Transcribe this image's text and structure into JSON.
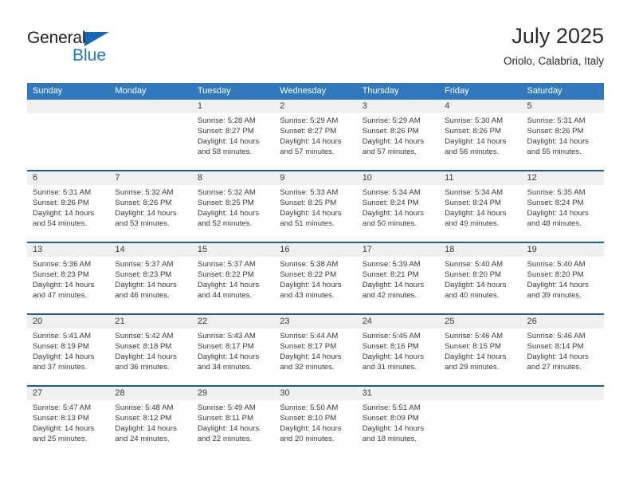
{
  "brand": {
    "name_top": "General",
    "name_bottom": "Blue",
    "triangle_color": "#1667b2",
    "blue_text_color": "#1a7ac4"
  },
  "header": {
    "title": "July 2025",
    "subtitle": "Oriolo, Calabria, Italy"
  },
  "theme": {
    "header_bg": "#3179bc",
    "week_separator": "#1c5fa0",
    "date_band_bg": "#f0f0f0",
    "text": "#3a3a3a"
  },
  "weekdays": [
    "Sunday",
    "Monday",
    "Tuesday",
    "Wednesday",
    "Thursday",
    "Friday",
    "Saturday"
  ],
  "weeks": [
    {
      "days": [
        {
          "num": "",
          "sunrise": "",
          "sunset": "",
          "daylight1": "",
          "daylight2": ""
        },
        {
          "num": "",
          "sunrise": "",
          "sunset": "",
          "daylight1": "",
          "daylight2": ""
        },
        {
          "num": "1",
          "sunrise": "Sunrise: 5:28 AM",
          "sunset": "Sunset: 8:27 PM",
          "daylight1": "Daylight: 14 hours",
          "daylight2": "and 58 minutes."
        },
        {
          "num": "2",
          "sunrise": "Sunrise: 5:29 AM",
          "sunset": "Sunset: 8:27 PM",
          "daylight1": "Daylight: 14 hours",
          "daylight2": "and 57 minutes."
        },
        {
          "num": "3",
          "sunrise": "Sunrise: 5:29 AM",
          "sunset": "Sunset: 8:26 PM",
          "daylight1": "Daylight: 14 hours",
          "daylight2": "and 57 minutes."
        },
        {
          "num": "4",
          "sunrise": "Sunrise: 5:30 AM",
          "sunset": "Sunset: 8:26 PM",
          "daylight1": "Daylight: 14 hours",
          "daylight2": "and 56 minutes."
        },
        {
          "num": "5",
          "sunrise": "Sunrise: 5:31 AM",
          "sunset": "Sunset: 8:26 PM",
          "daylight1": "Daylight: 14 hours",
          "daylight2": "and 55 minutes."
        }
      ]
    },
    {
      "days": [
        {
          "num": "6",
          "sunrise": "Sunrise: 5:31 AM",
          "sunset": "Sunset: 8:26 PM",
          "daylight1": "Daylight: 14 hours",
          "daylight2": "and 54 minutes."
        },
        {
          "num": "7",
          "sunrise": "Sunrise: 5:32 AM",
          "sunset": "Sunset: 8:26 PM",
          "daylight1": "Daylight: 14 hours",
          "daylight2": "and 53 minutes."
        },
        {
          "num": "8",
          "sunrise": "Sunrise: 5:32 AM",
          "sunset": "Sunset: 8:25 PM",
          "daylight1": "Daylight: 14 hours",
          "daylight2": "and 52 minutes."
        },
        {
          "num": "9",
          "sunrise": "Sunrise: 5:33 AM",
          "sunset": "Sunset: 8:25 PM",
          "daylight1": "Daylight: 14 hours",
          "daylight2": "and 51 minutes."
        },
        {
          "num": "10",
          "sunrise": "Sunrise: 5:34 AM",
          "sunset": "Sunset: 8:24 PM",
          "daylight1": "Daylight: 14 hours",
          "daylight2": "and 50 minutes."
        },
        {
          "num": "11",
          "sunrise": "Sunrise: 5:34 AM",
          "sunset": "Sunset: 8:24 PM",
          "daylight1": "Daylight: 14 hours",
          "daylight2": "and 49 minutes."
        },
        {
          "num": "12",
          "sunrise": "Sunrise: 5:35 AM",
          "sunset": "Sunset: 8:24 PM",
          "daylight1": "Daylight: 14 hours",
          "daylight2": "and 48 minutes."
        }
      ]
    },
    {
      "days": [
        {
          "num": "13",
          "sunrise": "Sunrise: 5:36 AM",
          "sunset": "Sunset: 8:23 PM",
          "daylight1": "Daylight: 14 hours",
          "daylight2": "and 47 minutes."
        },
        {
          "num": "14",
          "sunrise": "Sunrise: 5:37 AM",
          "sunset": "Sunset: 8:23 PM",
          "daylight1": "Daylight: 14 hours",
          "daylight2": "and 46 minutes."
        },
        {
          "num": "15",
          "sunrise": "Sunrise: 5:37 AM",
          "sunset": "Sunset: 8:22 PM",
          "daylight1": "Daylight: 14 hours",
          "daylight2": "and 44 minutes."
        },
        {
          "num": "16",
          "sunrise": "Sunrise: 5:38 AM",
          "sunset": "Sunset: 8:22 PM",
          "daylight1": "Daylight: 14 hours",
          "daylight2": "and 43 minutes."
        },
        {
          "num": "17",
          "sunrise": "Sunrise: 5:39 AM",
          "sunset": "Sunset: 8:21 PM",
          "daylight1": "Daylight: 14 hours",
          "daylight2": "and 42 minutes."
        },
        {
          "num": "18",
          "sunrise": "Sunrise: 5:40 AM",
          "sunset": "Sunset: 8:20 PM",
          "daylight1": "Daylight: 14 hours",
          "daylight2": "and 40 minutes."
        },
        {
          "num": "19",
          "sunrise": "Sunrise: 5:40 AM",
          "sunset": "Sunset: 8:20 PM",
          "daylight1": "Daylight: 14 hours",
          "daylight2": "and 39 minutes."
        }
      ]
    },
    {
      "days": [
        {
          "num": "20",
          "sunrise": "Sunrise: 5:41 AM",
          "sunset": "Sunset: 8:19 PM",
          "daylight1": "Daylight: 14 hours",
          "daylight2": "and 37 minutes."
        },
        {
          "num": "21",
          "sunrise": "Sunrise: 5:42 AM",
          "sunset": "Sunset: 8:18 PM",
          "daylight1": "Daylight: 14 hours",
          "daylight2": "and 36 minutes."
        },
        {
          "num": "22",
          "sunrise": "Sunrise: 5:43 AM",
          "sunset": "Sunset: 8:17 PM",
          "daylight1": "Daylight: 14 hours",
          "daylight2": "and 34 minutes."
        },
        {
          "num": "23",
          "sunrise": "Sunrise: 5:44 AM",
          "sunset": "Sunset: 8:17 PM",
          "daylight1": "Daylight: 14 hours",
          "daylight2": "and 32 minutes."
        },
        {
          "num": "24",
          "sunrise": "Sunrise: 5:45 AM",
          "sunset": "Sunset: 8:16 PM",
          "daylight1": "Daylight: 14 hours",
          "daylight2": "and 31 minutes."
        },
        {
          "num": "25",
          "sunrise": "Sunrise: 5:46 AM",
          "sunset": "Sunset: 8:15 PM",
          "daylight1": "Daylight: 14 hours",
          "daylight2": "and 29 minutes."
        },
        {
          "num": "26",
          "sunrise": "Sunrise: 5:46 AM",
          "sunset": "Sunset: 8:14 PM",
          "daylight1": "Daylight: 14 hours",
          "daylight2": "and 27 minutes."
        }
      ]
    },
    {
      "days": [
        {
          "num": "27",
          "sunrise": "Sunrise: 5:47 AM",
          "sunset": "Sunset: 8:13 PM",
          "daylight1": "Daylight: 14 hours",
          "daylight2": "and 25 minutes."
        },
        {
          "num": "28",
          "sunrise": "Sunrise: 5:48 AM",
          "sunset": "Sunset: 8:12 PM",
          "daylight1": "Daylight: 14 hours",
          "daylight2": "and 24 minutes."
        },
        {
          "num": "29",
          "sunrise": "Sunrise: 5:49 AM",
          "sunset": "Sunset: 8:11 PM",
          "daylight1": "Daylight: 14 hours",
          "daylight2": "and 22 minutes."
        },
        {
          "num": "30",
          "sunrise": "Sunrise: 5:50 AM",
          "sunset": "Sunset: 8:10 PM",
          "daylight1": "Daylight: 14 hours",
          "daylight2": "and 20 minutes."
        },
        {
          "num": "31",
          "sunrise": "Sunrise: 5:51 AM",
          "sunset": "Sunset: 8:09 PM",
          "daylight1": "Daylight: 14 hours",
          "daylight2": "and 18 minutes."
        },
        {
          "num": "",
          "sunrise": "",
          "sunset": "",
          "daylight1": "",
          "daylight2": ""
        },
        {
          "num": "",
          "sunrise": "",
          "sunset": "",
          "daylight1": "",
          "daylight2": ""
        }
      ]
    }
  ]
}
